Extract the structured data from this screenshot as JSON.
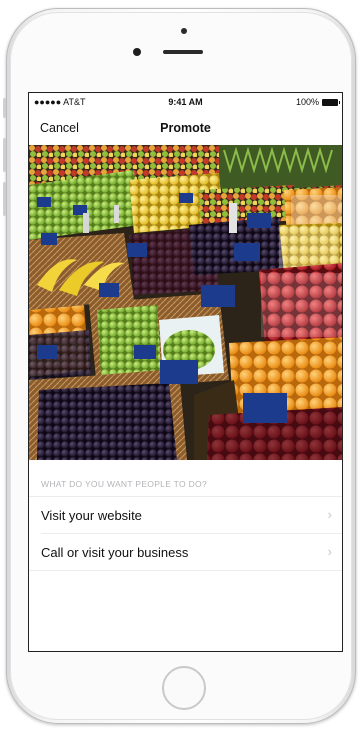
{
  "status_bar": {
    "carrier": "●●●●● AT&T",
    "time": "9:41 AM",
    "battery": "100%"
  },
  "nav": {
    "cancel": "Cancel",
    "title": "Promote"
  },
  "question": "WHAT DO YOU WANT PEOPLE TO DO?",
  "options": [
    {
      "label": "Visit your website",
      "icon": "chevron-right-icon"
    },
    {
      "label": "Call or visit your business",
      "icon": "chevron-right-icon"
    }
  ],
  "colors": {
    "accent_text": "#111111",
    "muted": "#b4b4b8",
    "chevron": "#c7c7cc"
  }
}
